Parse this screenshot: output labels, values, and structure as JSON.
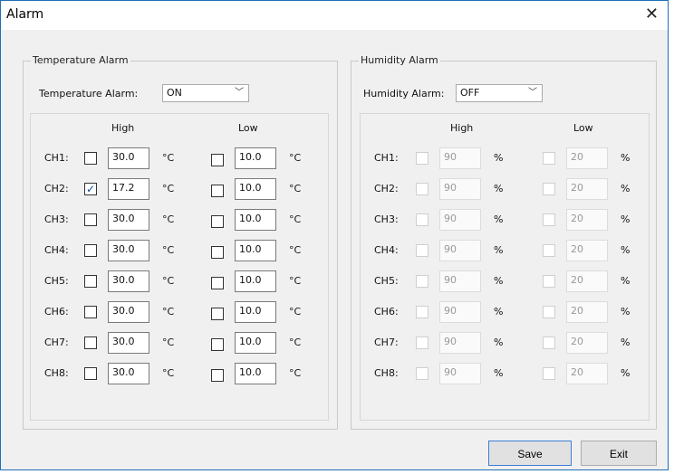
{
  "window": {
    "title": "Alarm"
  },
  "temperature": {
    "group_title": "Temperature Alarm",
    "alarm_label": "Temperature Alarm:",
    "alarm_value": "ON",
    "high_header": "High",
    "low_header": "Low",
    "unit": "°C",
    "channels": [
      {
        "label": "CH1:",
        "high_checked": false,
        "high": "30.0",
        "low_checked": false,
        "low": "10.0"
      },
      {
        "label": "CH2:",
        "high_checked": true,
        "high": "17.2",
        "low_checked": false,
        "low": "10.0"
      },
      {
        "label": "CH3:",
        "high_checked": false,
        "high": "30.0",
        "low_checked": false,
        "low": "10.0"
      },
      {
        "label": "CH4:",
        "high_checked": false,
        "high": "30.0",
        "low_checked": false,
        "low": "10.0"
      },
      {
        "label": "CH5:",
        "high_checked": false,
        "high": "30.0",
        "low_checked": false,
        "low": "10.0"
      },
      {
        "label": "CH6:",
        "high_checked": false,
        "high": "30.0",
        "low_checked": false,
        "low": "10.0"
      },
      {
        "label": "CH7:",
        "high_checked": false,
        "high": "30.0",
        "low_checked": false,
        "low": "10.0"
      },
      {
        "label": "CH8:",
        "high_checked": false,
        "high": "30.0",
        "low_checked": false,
        "low": "10.0"
      }
    ]
  },
  "humidity": {
    "group_title": "Humidity Alarm",
    "alarm_label": "Humidity Alarm:",
    "alarm_value": "OFF",
    "high_header": "High",
    "low_header": "Low",
    "unit": "%",
    "channels": [
      {
        "label": "CH1:",
        "high": "90",
        "low": "20"
      },
      {
        "label": "CH2:",
        "high": "90",
        "low": "20"
      },
      {
        "label": "CH3:",
        "high": "90",
        "low": "20"
      },
      {
        "label": "CH4:",
        "high": "90",
        "low": "20"
      },
      {
        "label": "CH5:",
        "high": "90",
        "low": "20"
      },
      {
        "label": "CH6:",
        "high": "90",
        "low": "20"
      },
      {
        "label": "CH7:",
        "high": "90",
        "low": "20"
      },
      {
        "label": "CH8:",
        "high": "90",
        "low": "20"
      }
    ]
  },
  "buttons": {
    "save": "Save",
    "exit": "Exit"
  },
  "icons": {
    "close": "close-icon",
    "dropdown": "chevron-down-icon",
    "check": "checkmark-icon"
  },
  "colors": {
    "window_border": "#1f6fb6",
    "check": "#0b4ea2"
  }
}
